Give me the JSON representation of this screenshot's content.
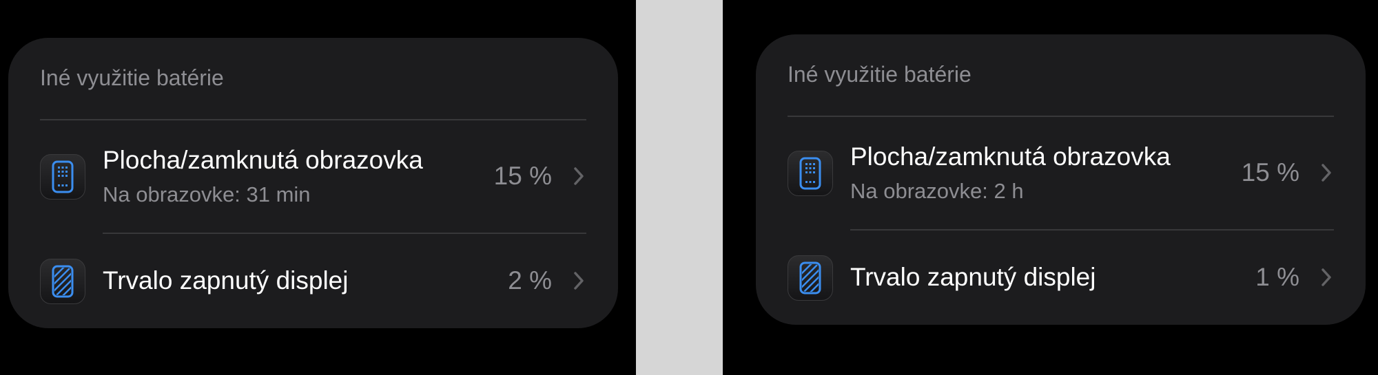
{
  "colors": {
    "background": "#000000",
    "strip": "#d6d6d6",
    "panel": "#1c1c1e",
    "primary_text": "#ffffff",
    "secondary_text": "#8e8e93",
    "icon_accent": "#3b8ef0"
  },
  "left": {
    "section_title": "Iné využitie batérie",
    "rows": [
      {
        "icon": "phone-home-screen-icon",
        "title": "Plocha/zamknutá obrazovka",
        "subtitle": "Na obrazovke: 31 min",
        "value": "15 %"
      },
      {
        "icon": "always-on-display-icon",
        "title": "Trvalo zapnutý displej",
        "value": "2 %"
      }
    ]
  },
  "right": {
    "section_title": "Iné využitie batérie",
    "rows": [
      {
        "icon": "phone-home-screen-icon",
        "title": "Plocha/zamknutá obrazovka",
        "subtitle": "Na obrazovke: 2 h",
        "value": "15 %"
      },
      {
        "icon": "always-on-display-icon",
        "title": "Trvalo zapnutý displej",
        "value": "1 %"
      }
    ]
  }
}
